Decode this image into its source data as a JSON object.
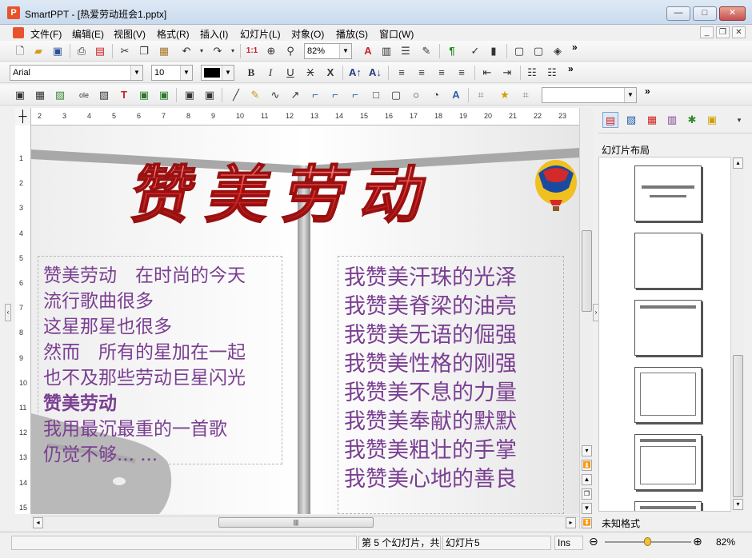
{
  "window": {
    "app_name": "SmartPPT",
    "document": "热爱劳动班会1.pptx",
    "title": "SmartPPT - [热爱劳动班会1.pptx]",
    "logo_letter": "P",
    "controls": {
      "minimize": "—",
      "maximize": "□",
      "close": "✕"
    }
  },
  "menu": {
    "items": [
      "文件(F)",
      "编辑(E)",
      "视图(V)",
      "格式(R)",
      "插入(I)",
      "幻灯片(L)",
      "对象(O)",
      "播放(S)",
      "窗口(W)"
    ],
    "mdi": {
      "minimize": "_",
      "restore": "❐",
      "close": "✕"
    }
  },
  "toolbar1": {
    "zoom_value": "82%",
    "overflow": "»"
  },
  "toolbar2": {
    "font_name": "Arial",
    "font_size": "10",
    "font_color": "#000000",
    "overflow": "»"
  },
  "toolbar3": {
    "style_value": "",
    "overflow": "»"
  },
  "ruler": {
    "horizontal": [
      "2",
      "3",
      "4",
      "5",
      "6",
      "7",
      "8",
      "9",
      "10",
      "11",
      "12",
      "13",
      "14",
      "15",
      "16",
      "17",
      "18",
      "19",
      "20",
      "21",
      "22",
      "23"
    ],
    "vertical": [
      "1",
      "2",
      "3",
      "4",
      "5",
      "6",
      "7",
      "8",
      "9",
      "10",
      "11",
      "12",
      "13",
      "14",
      "15"
    ]
  },
  "slide": {
    "title_art": "赞美劳动",
    "left_poem": [
      "赞美劳动　在时尚的今天",
      "流行歌曲很多",
      "这星那星也很多",
      "然而　所有的星加在一起",
      "也不及那些劳动巨星闪光",
      "赞美劳动",
      "我用最沉最重的一首歌",
      "仍觉不够... ..."
    ],
    "right_poem": [
      "我赞美汗珠的光泽",
      "我赞美脊梁的油亮",
      "我赞美无语的倔强",
      "我赞美性格的刚强",
      "我赞美不息的力量",
      "我赞美奉献的默默",
      "我赞美粗壮的手掌",
      "我赞美心地的善良"
    ],
    "text_color": "#7a3f92",
    "title_color": "#d42a2a"
  },
  "task_pane": {
    "title": "幻灯片布局",
    "footer": "未知格式",
    "dropdown": "▾"
  },
  "statusbar": {
    "slide_info": "第 5 个幻灯片，共",
    "slide_name": "幻灯片5",
    "mode": "Ins",
    "zoom_value": 0.5,
    "zoom": "82%"
  }
}
